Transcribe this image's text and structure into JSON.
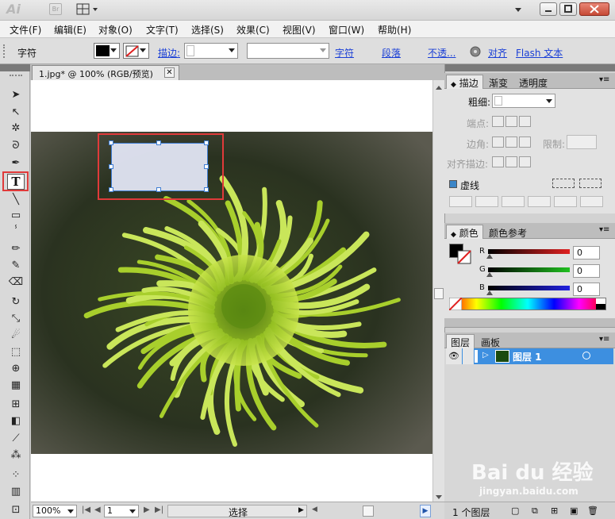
{
  "title_bar": {
    "logo": "Ai",
    "bridge_logo": "Br"
  },
  "menu": [
    "文件(F)",
    "编辑(E)",
    "对象(O)",
    "文字(T)",
    "选择(S)",
    "效果(C)",
    "视图(V)",
    "窗口(W)",
    "帮助(H)"
  ],
  "control_bar": {
    "label": "字符",
    "stroke_label": "描边:",
    "char_link": "字符",
    "para_link": "段落",
    "opacity_link": "不透...",
    "align_link": "对齐",
    "flash_link": "Flash 文本"
  },
  "document": {
    "tab_title": "1.jpg* @ 100% (RGB/预览)"
  },
  "status_bar": {
    "zoom": "100%",
    "page": "1",
    "mode": "选择"
  },
  "stroke_panel": {
    "tabs": [
      "描边",
      "渐变",
      "透明度"
    ],
    "weight_label": "粗细:",
    "cap_label": "端点:",
    "corner_label": "边角:",
    "limit_label": "限制:",
    "align_label": "对齐描边:",
    "dashed_label": "虚线"
  },
  "color_panel": {
    "tabs": [
      "颜色",
      "颜色参考"
    ],
    "channels": [
      {
        "name": "R",
        "value": "0",
        "color": "#e02020"
      },
      {
        "name": "G",
        "value": "0",
        "color": "#20c020"
      },
      {
        "name": "B",
        "value": "0",
        "color": "#2020e0"
      }
    ]
  },
  "layers_panel": {
    "tabs": [
      "图层",
      "画板"
    ],
    "layers": [
      {
        "name": "图层 1"
      }
    ],
    "count_label": "1 个图层"
  },
  "colors": {
    "accent": "#3d8fe0",
    "highlight": "#e03a3a",
    "link": "#1a3fd6"
  },
  "watermark": {
    "brand": "Bai du 经验",
    "url": "jingyan.baidu.com"
  }
}
